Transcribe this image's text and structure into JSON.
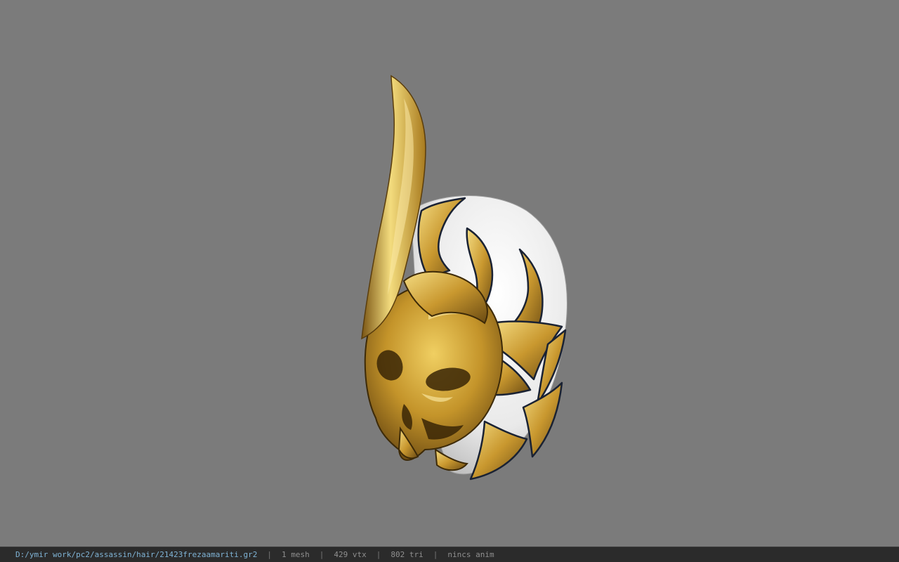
{
  "viewer": {
    "background_color": "#7b7b7b",
    "model": {
      "subject": "gold-and-white-skull-helmet",
      "colors": {
        "gold_light": "#f0d36a",
        "gold_mid": "#c99a2e",
        "gold_dark": "#6b4a12",
        "white": "#f2f2f2",
        "outline": "#1a2233"
      }
    }
  },
  "statusbar": {
    "file_path": "D:/ymir work/pc2/assassin/hair/21423frezaamariti.gr2",
    "separator": "|",
    "mesh_count": "1 mesh",
    "vertex_count": "429 vtx",
    "triangle_count": "802 tri",
    "animation_status": "nincs anim"
  }
}
